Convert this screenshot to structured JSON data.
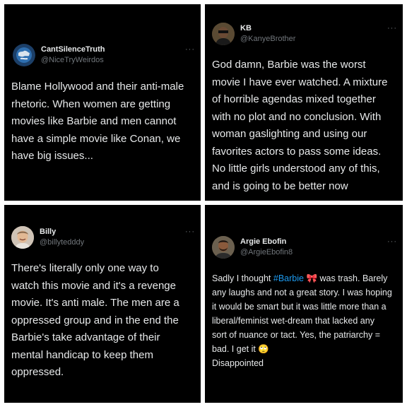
{
  "tweets": [
    {
      "name": "CantSilenceTruth",
      "handle": "@NiceTryWeirdos",
      "more": "···",
      "avatar_icon": "earth-globe-avatar",
      "text": "Blame Hollywood and their anti-male\nrhetoric. When women are getting\nmovies like Barbie and men cannot\nhave a simple movie like Conan, we\nhave big issues..."
    },
    {
      "name": "KB",
      "handle": "@KanyeBrother",
      "more": "···",
      "avatar_icon": "person-with-sunglasses-avatar",
      "text": "God damn, Barbie was the worst\nmovie I have ever watched. A mixture\nof horrible agendas mixed together\nwith no plot and no conclusion. With\nwoman gaslighting and using our\nfavorites actors to pass some ideas.\nNo little girls understood any of this,\nand is going to be better now"
    },
    {
      "name": "Billy",
      "handle": "@billytedddy",
      "more": "···",
      "avatar_icon": "smiling-man-avatar",
      "text": "There's literally only one way to\nwatch this movie and it's a revenge\nmovie. It's anti male. The men are a\noppressed group and in the end the\nBarbie's take advantage of their\nmental handicap to keep them\noppressed."
    },
    {
      "name": "Argie Ebofin",
      "handle": "@ArgieEbofin8",
      "more": "···",
      "avatar_icon": "bearded-man-avatar",
      "text_before": "Sadly I thought ",
      "hashtag": "#Barbie",
      "emoji_pink": "🎀",
      "text_after": " was trash. Barely\nany laughs and not a great story. I was hoping\nit would be smart but it was little more than a\nliberal/feminist wet-dream that lacked any\nsort of nuance or tact. Yes, the patriarchy =\nbad. I get it ",
      "emoji_end": "🙄",
      "footer": "Disappointed"
    }
  ]
}
